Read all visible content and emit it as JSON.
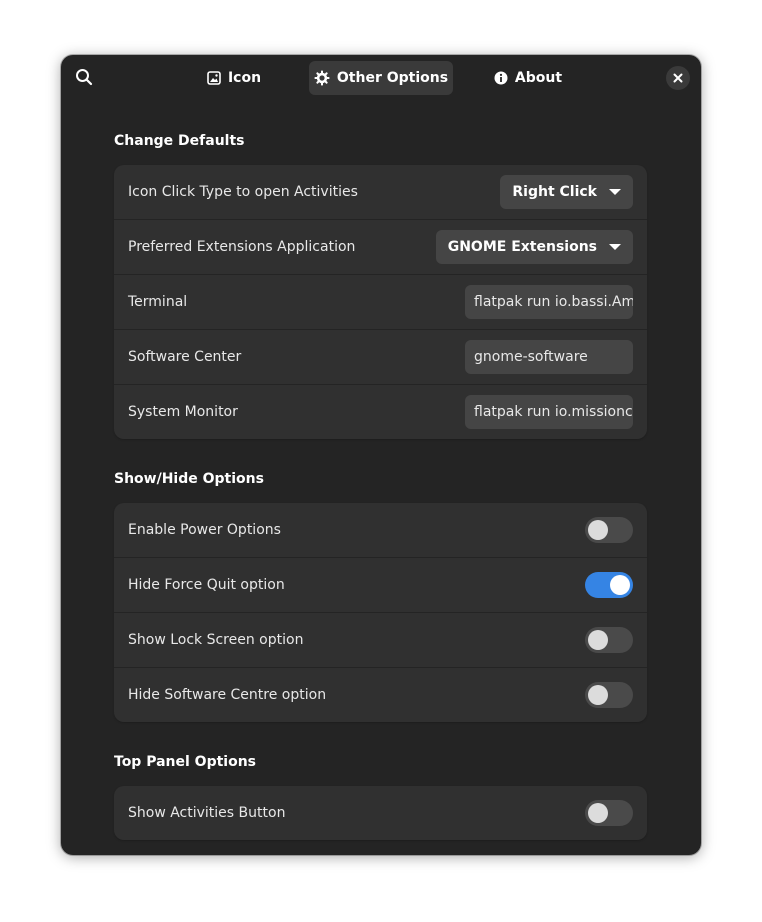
{
  "header": {
    "tabs": [
      {
        "label": "Icon",
        "icon": "image-icon",
        "active": false
      },
      {
        "label": "Other Options",
        "icon": "gear-icon",
        "active": true
      },
      {
        "label": "About",
        "icon": "info-icon",
        "active": false
      }
    ]
  },
  "change_defaults": {
    "title": "Change Defaults",
    "rows": [
      {
        "label": "Icon Click Type to open Activities",
        "control": "dropdown",
        "value": "Right Click"
      },
      {
        "label": "Preferred Extensions Application",
        "control": "dropdown",
        "value": "GNOME Extensions"
      },
      {
        "label": "Terminal",
        "control": "entry",
        "value": "flatpak run io.bassi.Amberol"
      },
      {
        "label": "Software Center",
        "control": "entry",
        "value": "gnome-software"
      },
      {
        "label": "System Monitor",
        "control": "entry",
        "value": "flatpak run io.missioncenter.MissionCenter"
      }
    ]
  },
  "show_hide": {
    "title": "Show/Hide Options",
    "rows": [
      {
        "label": "Enable Power Options",
        "enabled": false
      },
      {
        "label": "Hide Force Quit option",
        "enabled": true
      },
      {
        "label": "Show Lock Screen option",
        "enabled": false
      },
      {
        "label": "Hide Software Centre option",
        "enabled": false
      }
    ]
  },
  "top_panel": {
    "title": "Top Panel Options",
    "rows": [
      {
        "label": "Show Activities Button",
        "enabled": false
      }
    ]
  },
  "colors": {
    "accent": "#3584e4",
    "window_bg": "#242424",
    "row_bg": "#303030"
  }
}
